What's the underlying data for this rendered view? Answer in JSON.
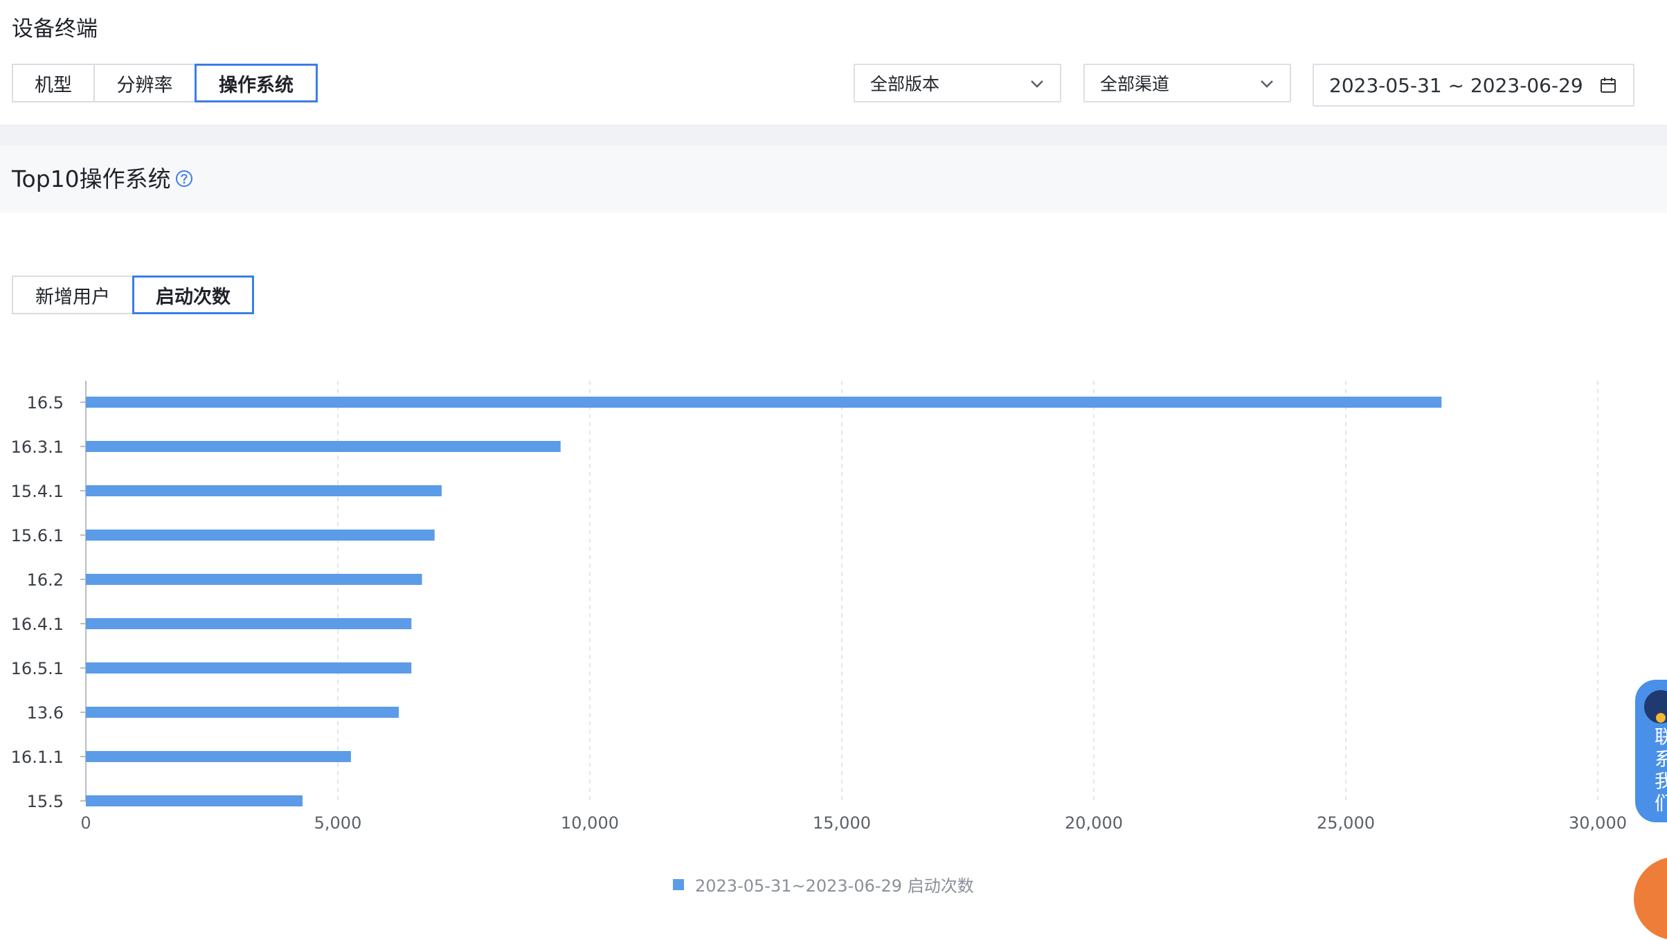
{
  "section_title": "设备终端",
  "dimension_tabs": [
    {
      "label": "机型",
      "active": false
    },
    {
      "label": "分辨率",
      "active": false
    },
    {
      "label": "操作系统",
      "active": true
    }
  ],
  "filters": {
    "version_select": "全部版本",
    "channel_select": "全部渠道",
    "date_range": "2023-05-31 ~ 2023-06-29"
  },
  "card_title": "Top10操作系统",
  "metric_tabs": [
    {
      "label": "新增用户",
      "active": false
    },
    {
      "label": "启动次数",
      "active": true
    }
  ],
  "colors": {
    "accent": "#3b7ee8",
    "bar": "#5b9be8",
    "widget": "#4a90e8",
    "widget_orange": "#ee7d3a"
  },
  "icons": {
    "help": "question-circle-icon",
    "chevron": "chevron-down-icon",
    "calendar": "calendar-icon"
  },
  "chart_data": {
    "type": "bar",
    "orientation": "horizontal",
    "categories": [
      "16.5",
      "16.3.1",
      "15.4.1",
      "15.6.1",
      "16.2",
      "16.4.1",
      "16.5.1",
      "13.6",
      "16.1.1",
      "15.5"
    ],
    "series": [
      {
        "name": "2023-05-31~2023-06-29 启动次数",
        "values": [
          26900,
          9420,
          7060,
          6920,
          6670,
          6460,
          6460,
          6210,
          5260,
          4300
        ]
      }
    ],
    "xlim": [
      0,
      30000
    ],
    "xticks": [
      "0",
      "5,000",
      "10,000",
      "15,000",
      "20,000",
      "25,000",
      "30,000"
    ],
    "grid": "vertical dashed",
    "legend": "bottom-center"
  },
  "contact_widget": {
    "text": "联系我们"
  }
}
